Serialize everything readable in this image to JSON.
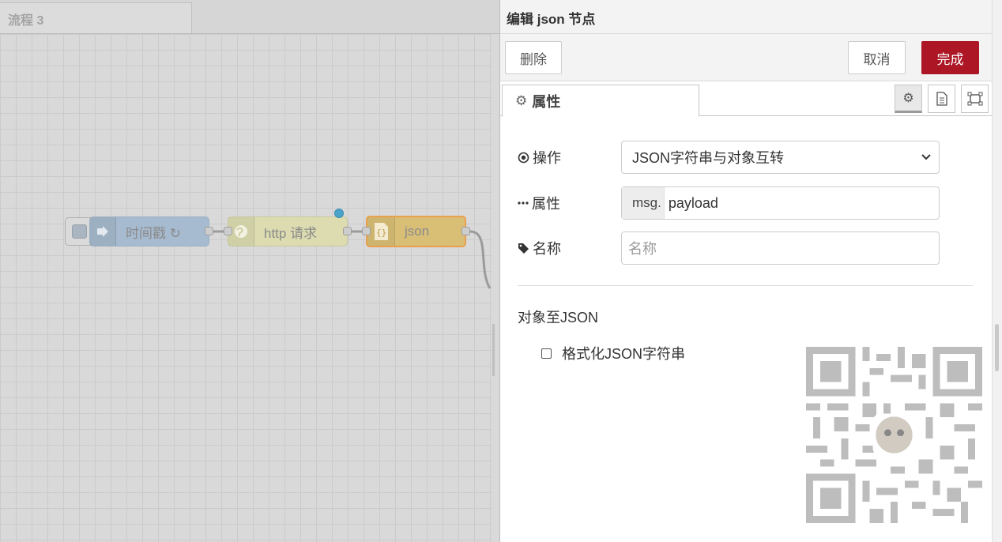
{
  "workspace": {
    "flow_tab": "流程 3",
    "nodes": [
      {
        "label": "时间戳 ↻",
        "icon": "arrow-right-icon",
        "color": "#a6bbcf"
      },
      {
        "label": "http 请求",
        "icon": "globe-icon",
        "color": "#e7e7ae"
      },
      {
        "label": "json",
        "icon": "braces-icon",
        "color": "#debd5c"
      }
    ]
  },
  "tray": {
    "title": "编辑 json 节点",
    "toolbar": {
      "delete_label": "删除",
      "cancel_label": "取消",
      "done_label": "完成"
    },
    "tab_properties": "属性",
    "form": {
      "action_label": "操作",
      "action_value": "JSON字符串与对象互转",
      "property_label": "属性",
      "property_prefix": "msg.",
      "property_value": "payload",
      "name_label": "名称",
      "name_placeholder": "名称"
    },
    "section_title": "对象至JSON",
    "format_checkbox_label": "格式化JSON字符串",
    "format_checked": false
  },
  "colors": {
    "primary": "#ad1625",
    "selected_node_border": "#ff7f0e",
    "changed_dot": "#4aa3c9"
  }
}
